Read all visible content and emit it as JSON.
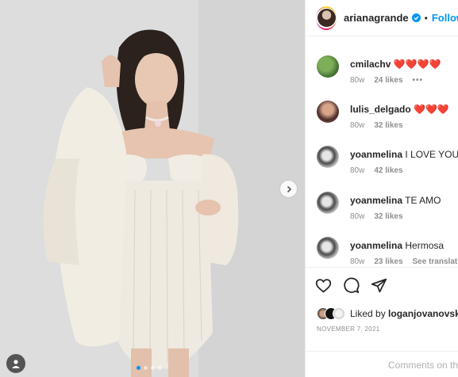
{
  "post": {
    "username": "arianagrande",
    "separator": "•",
    "follow_label": "Follow",
    "accent_color": "#0095f6",
    "carousel": {
      "slide_count": 4,
      "active_slide": 1
    }
  },
  "comments": [
    {
      "user": "cmilachv",
      "text": "❤️❤️❤️❤️",
      "time": "80w",
      "likes": "24 likes",
      "extra": "•••",
      "extra_kind": "more"
    },
    {
      "user": "lulis_delgado",
      "text": "❤️❤️❤️",
      "time": "80w",
      "likes": "32 likes",
      "extra": "",
      "extra_kind": ""
    },
    {
      "user": "yoanmelina",
      "text": "I LOVE YOU A",
      "time": "80w",
      "likes": "42 likes",
      "extra": "",
      "extra_kind": ""
    },
    {
      "user": "yoanmelina",
      "text": "TE AMO",
      "time": "80w",
      "likes": "32 likes",
      "extra": "",
      "extra_kind": ""
    },
    {
      "user": "yoanmelina",
      "text": "Hermosa",
      "time": "80w",
      "likes": "23 likes",
      "extra": "See translation",
      "extra_kind": "translate"
    }
  ],
  "actions": {
    "liked_prefix": "Liked by",
    "liked_user": "loganjovanovsk",
    "date": "NOVEMBER 7, 2021"
  },
  "add_comment": {
    "placeholder": "Comments on this"
  },
  "icons": {
    "next": "chevron-right-icon",
    "tag": "user-tag-icon",
    "like": "heart-icon",
    "comment": "comment-bubble-icon",
    "share": "paper-plane-icon",
    "verified": "verified-badge-icon"
  }
}
